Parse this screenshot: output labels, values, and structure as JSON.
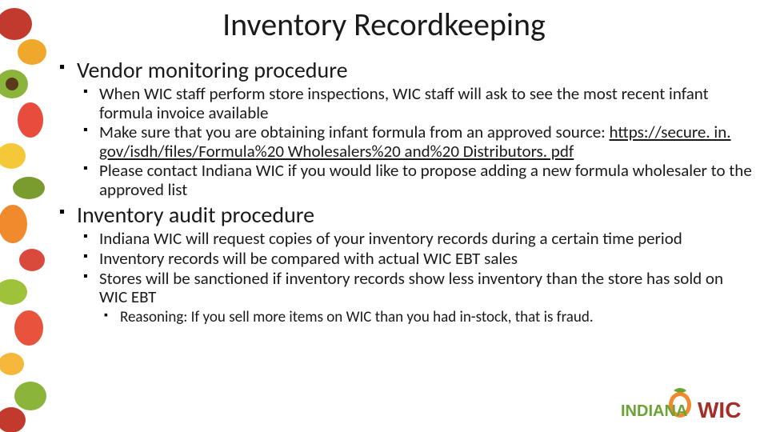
{
  "title": "Inventory Recordkeeping",
  "sections": [
    {
      "heading": "Vendor monitoring procedure",
      "bullets": [
        {
          "text": "When WIC staff perform store inspections, WIC staff will ask to see the most recent infant formula invoice available"
        },
        {
          "text_prefix": "Make sure that you are obtaining infant formula from an approved source: ",
          "link": "https://secure. in. gov/isdh/files/Formula%20 Wholesalers%20 and%20 Distributors. pdf"
        },
        {
          "text": "Please contact Indiana WIC if you would like to propose adding a new formula wholesaler to the approved list"
        }
      ]
    },
    {
      "heading": "Inventory audit procedure",
      "bullets": [
        {
          "text": "Indiana WIC will request copies of your inventory records during a certain time period"
        },
        {
          "text": "Inventory records will be compared with actual WIC EBT sales"
        },
        {
          "text": "Stores will be sanctioned if inventory records show less inventory than the store has sold on WIC EBT",
          "sub": [
            {
              "text": "Reasoning: If you sell more items on WIC than you had in-stock, that is fraud."
            }
          ]
        }
      ]
    }
  ],
  "logo": {
    "text_indiana": "INDIANA",
    "text_wic": "WIC",
    "color_indiana": "#6aa334",
    "color_wic": "#a33027",
    "color_leaf": "#6aa334",
    "color_fruit": "#f08a2c"
  }
}
